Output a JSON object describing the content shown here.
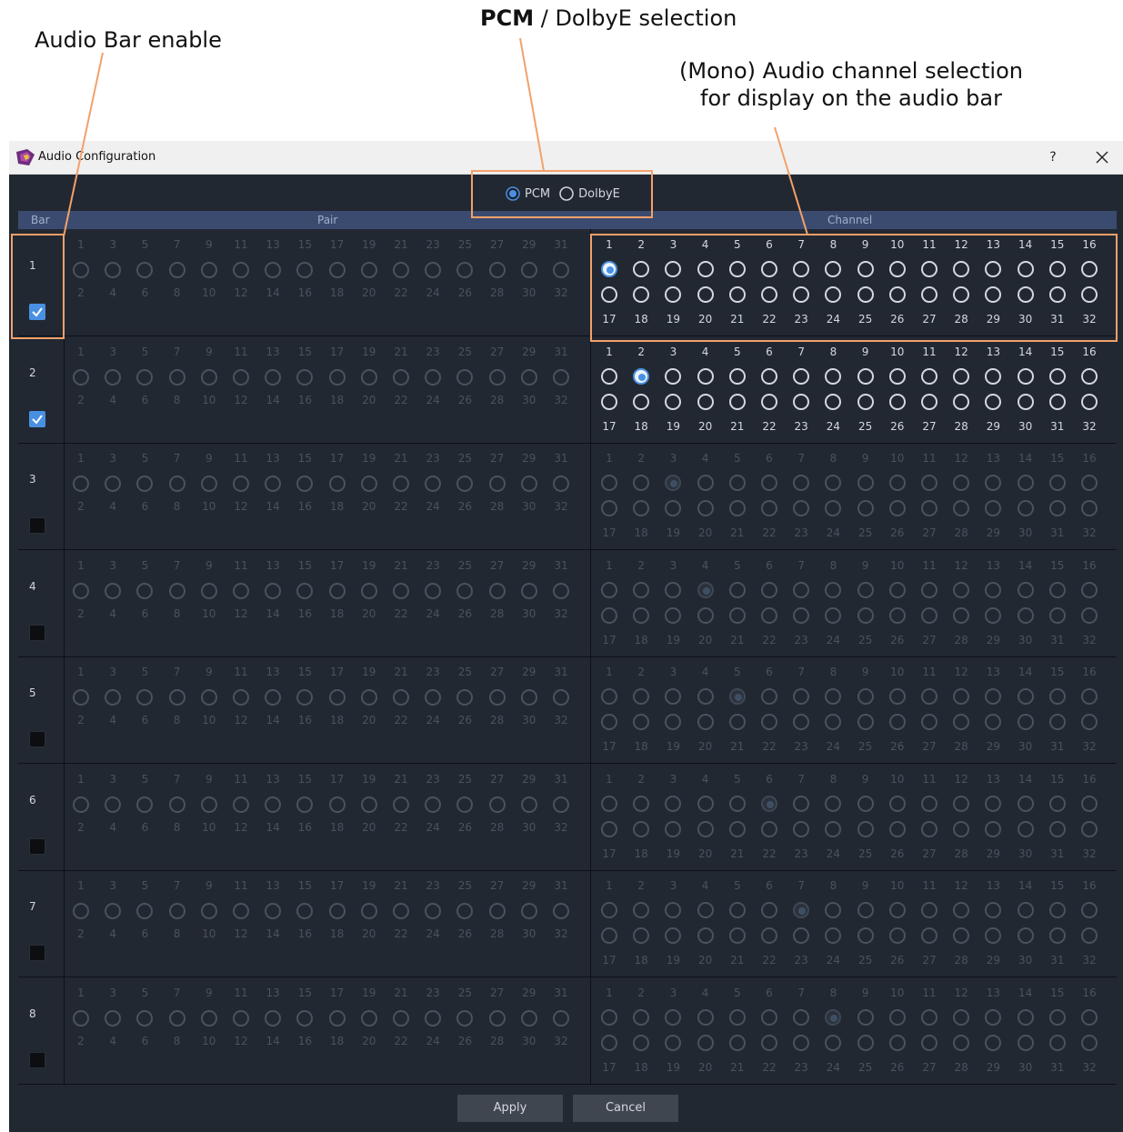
{
  "callouts": {
    "audio_bar_enable": "Audio Bar enable",
    "pcm_bold": "PCM",
    "pcm_rest": " / DolbyE selection",
    "mono_line1": "(Mono) Audio channel selection",
    "mono_line2": "for display on the audio bar"
  },
  "window": {
    "title": "Audio Configuration",
    "help_label": "?"
  },
  "mode": {
    "options": [
      "PCM",
      "DolbyE"
    ],
    "selected": "PCM"
  },
  "columns": {
    "bar": "Bar",
    "pair": "Pair",
    "channel": "Channel"
  },
  "pair_numbers_top": [
    "1",
    "3",
    "5",
    "7",
    "9",
    "11",
    "13",
    "15",
    "17",
    "19",
    "21",
    "23",
    "25",
    "27",
    "29",
    "31"
  ],
  "pair_numbers_bottom": [
    "2",
    "4",
    "6",
    "8",
    "10",
    "12",
    "14",
    "16",
    "18",
    "20",
    "22",
    "24",
    "26",
    "28",
    "30",
    "32"
  ],
  "channel_numbers_top": [
    "1",
    "2",
    "3",
    "4",
    "5",
    "6",
    "7",
    "8",
    "9",
    "10",
    "11",
    "12",
    "13",
    "14",
    "15",
    "16"
  ],
  "channel_numbers_bottom": [
    "17",
    "18",
    "19",
    "20",
    "21",
    "22",
    "23",
    "24",
    "25",
    "26",
    "27",
    "28",
    "29",
    "30",
    "31",
    "32"
  ],
  "bars": [
    {
      "label": "1",
      "enabled": true,
      "selected_channel": 1
    },
    {
      "label": "2",
      "enabled": true,
      "selected_channel": 2
    },
    {
      "label": "3",
      "enabled": false,
      "selected_channel": 3
    },
    {
      "label": "4",
      "enabled": false,
      "selected_channel": 4
    },
    {
      "label": "5",
      "enabled": false,
      "selected_channel": 5
    },
    {
      "label": "6",
      "enabled": false,
      "selected_channel": 6
    },
    {
      "label": "7",
      "enabled": false,
      "selected_channel": 7
    },
    {
      "label": "8",
      "enabled": false,
      "selected_channel": 8
    }
  ],
  "buttons": {
    "apply": "Apply",
    "cancel": "Cancel"
  },
  "colors": {
    "accent": "#4a90e2",
    "callout_outline": "#f2a16a",
    "panel_bg": "#222832",
    "header_bg": "#3b4b70",
    "text_active": "#d4d8de",
    "text_disabled": "#4a525d"
  }
}
